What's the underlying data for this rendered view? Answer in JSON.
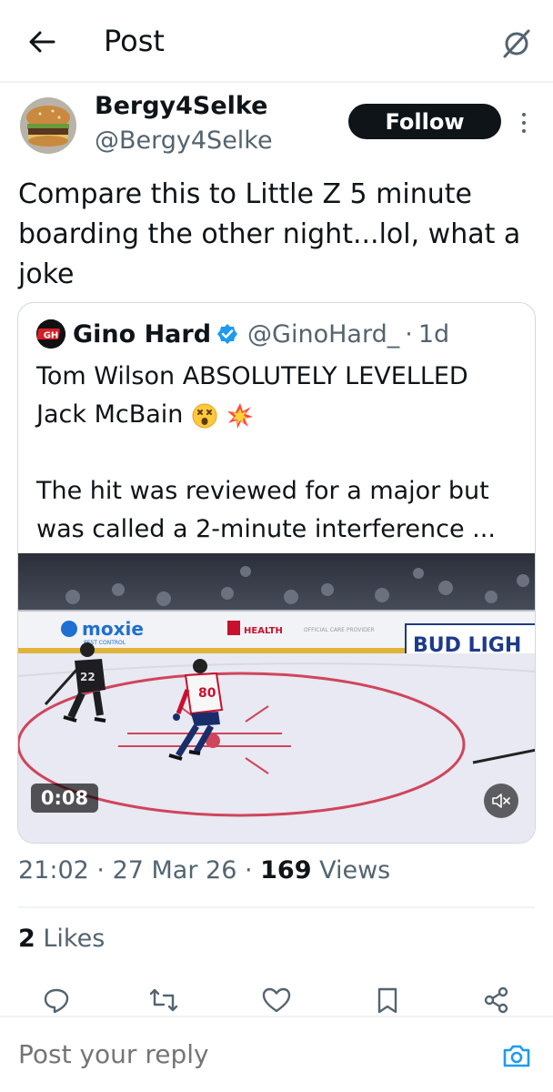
{
  "header": {
    "title": "Post",
    "back_icon": "arrow-left-icon",
    "grok_icon": "grok-icon"
  },
  "author": {
    "name": "Bergy4Selke",
    "handle": "@Bergy4Selke",
    "follow_label": "Follow"
  },
  "post": {
    "text": "Compare this to Little Z 5 minute boarding the other night...lol, what a joke"
  },
  "quote": {
    "avatar_text": "GH",
    "name": "Gino Hard",
    "handle": "@GinoHard_",
    "separator": "·",
    "time": "1d",
    "line1": "Tom Wilson ABSOLUTELY LEVELLED",
    "line2": "Jack McBain",
    "line3": "The hit was reviewed for a major but",
    "line4": "was called a 2-minute interference ...",
    "video": {
      "duration": "0:08",
      "board_ads": [
        "moxie",
        "PEST CONTROL",
        "HEALTH",
        "OFFICIAL CARE PROVIDER",
        "BUD LIGH"
      ],
      "player_numbers": [
        "22",
        "80"
      ]
    }
  },
  "meta": {
    "time": "21:02",
    "sep1": " · ",
    "date": "27 Mar 26",
    "sep2": " · ",
    "views_count": "169",
    "views_label": " Views"
  },
  "likes": {
    "count": "2",
    "label": " Likes"
  },
  "actions": [
    "reply-icon",
    "repost-icon",
    "like-icon",
    "bookmark-icon",
    "share-icon"
  ],
  "reply": {
    "placeholder": "Post your reply"
  },
  "colors": {
    "text": "#0f1419",
    "secondary": "#536471",
    "accent": "#1d9bf0",
    "border": "#cfd9de"
  }
}
